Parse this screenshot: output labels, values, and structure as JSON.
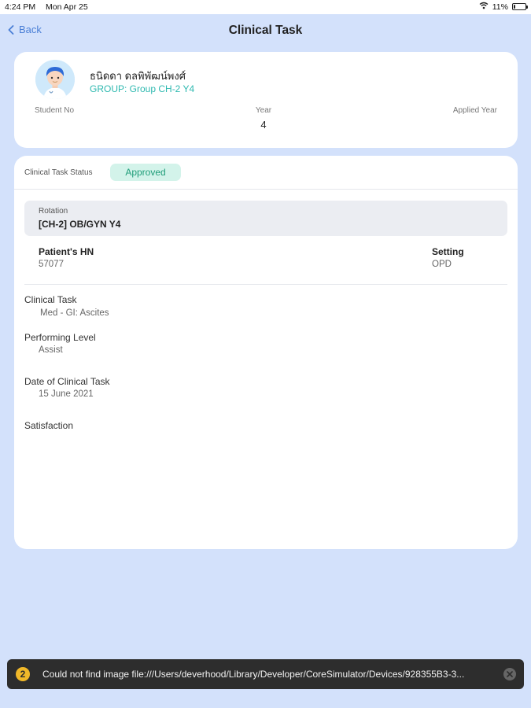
{
  "status_bar": {
    "time": "4:24 PM",
    "date": "Mon Apr 25",
    "battery": "11%",
    "battery_level": 0.11
  },
  "nav": {
    "back_label": "Back",
    "title": "Clinical Task"
  },
  "profile": {
    "name": "ธนิดดา ดลพิพัฒน์พงศ์",
    "group": "GROUP: Group CH-2 Y4",
    "student_no_label": "Student No",
    "student_no_value": "",
    "year_label": "Year",
    "year_value": "4",
    "applied_year_label": "Applied Year",
    "applied_year_value": ""
  },
  "task": {
    "status_label": "Clinical Task Status",
    "status_value": "Approved",
    "rotation_label": "Rotation",
    "rotation_value": "[CH-2] OB/GYN Y4",
    "hn_label": "Patient's HN",
    "hn_value": "57077",
    "setting_label": "Setting",
    "setting_value": "OPD",
    "clinical_task_label": "Clinical Task",
    "clinical_task_value": "Med - GI: Ascites",
    "performing_level_label": "Performing Level",
    "performing_level_value": "Assist",
    "date_label": "Date of Clinical Task",
    "date_value": "15 June 2021",
    "satisfaction_label": "Satisfaction"
  },
  "toast": {
    "count": "2",
    "message": "Could not find image file:///Users/deverhood/Library/Developer/CoreSimulator/Devices/928355B3-3..."
  },
  "colors": {
    "background": "#d3e1fb",
    "accent": "#4a7fd6",
    "group_text": "#2fb9b0",
    "approved_bg": "#d3f3ea",
    "approved_text": "#1f9d79"
  }
}
